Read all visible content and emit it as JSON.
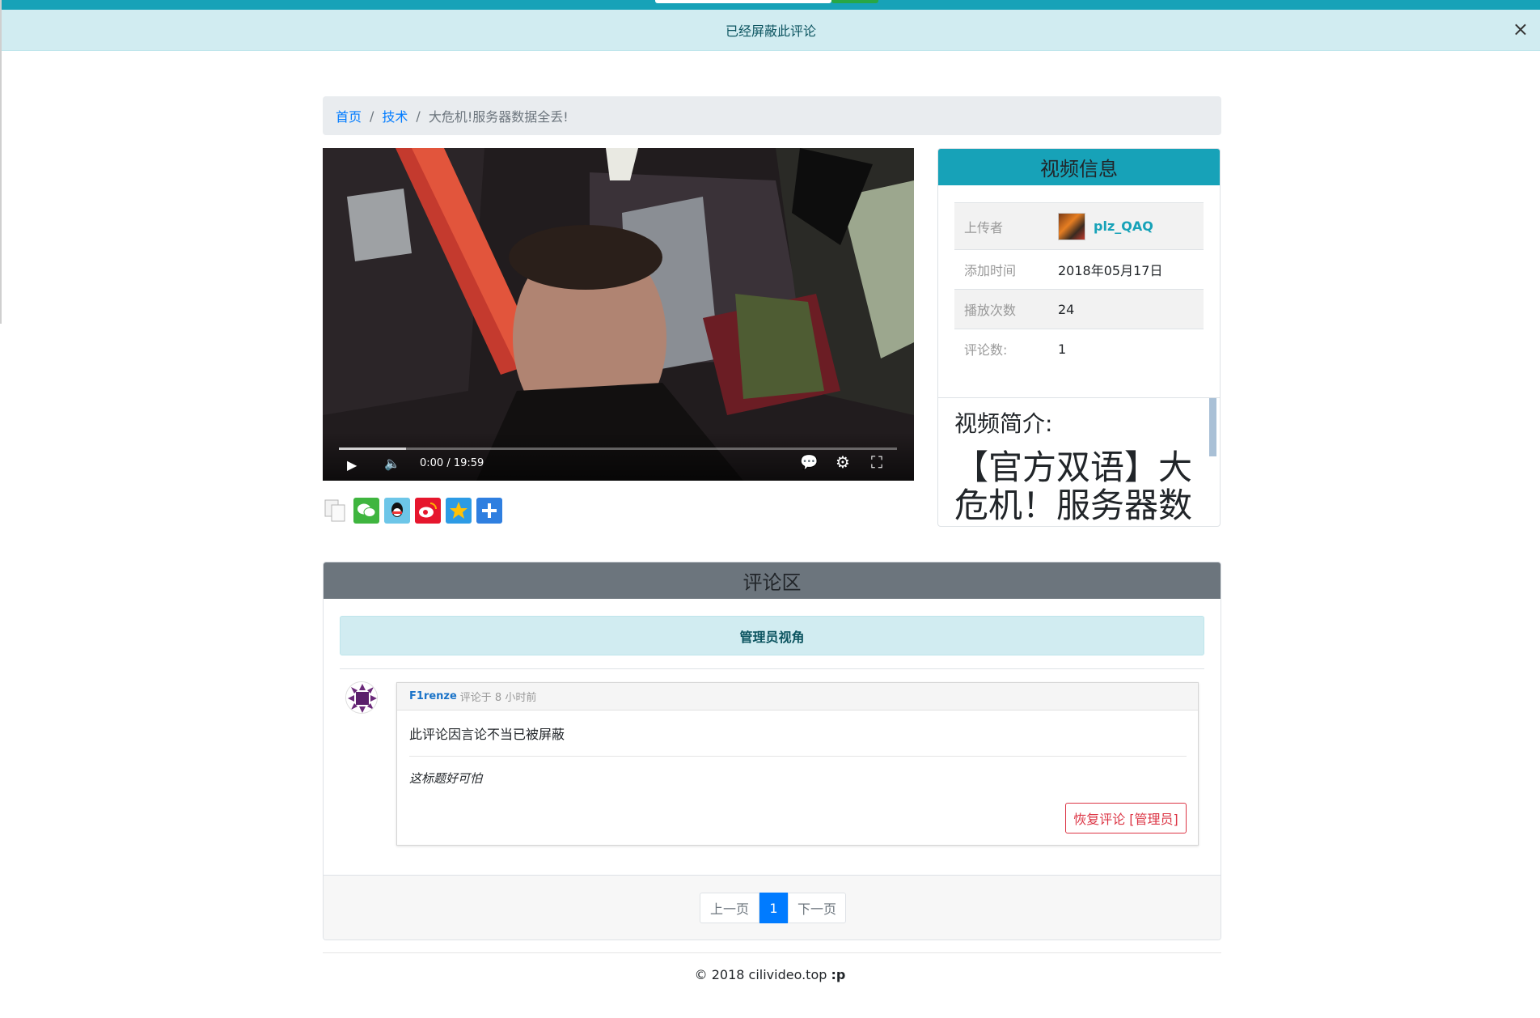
{
  "notice": {
    "text": "已经屏蔽此评论",
    "close": "×"
  },
  "breadcrumb": {
    "home": "首页",
    "category": "技术",
    "current": "大危机!服务器数据全丢!"
  },
  "player": {
    "time": "0:00 / 19:59",
    "progress_buffered": 0.12
  },
  "info": {
    "title": "视频信息",
    "rows": [
      {
        "key": "上传者",
        "value": "plz_QAQ"
      },
      {
        "key": "添加时间",
        "value": "2018年05月17日"
      },
      {
        "key": "播放次数",
        "value": "24"
      },
      {
        "key": "评论数:",
        "value": "1"
      }
    ],
    "desc_label": "视频简介:",
    "desc_text": "【官方双语】大危机！服务器数"
  },
  "comments": {
    "title": "评论区",
    "admin_view": "管理员视角",
    "items": [
      {
        "user": "F1renze",
        "meta": "评论于 8 小时前",
        "body": "此评论因言论不当已被屏蔽",
        "note": "这标题好可怕",
        "action": "恢复评论 [管理员]"
      }
    ],
    "pager": {
      "prev": "上一页",
      "current": "1",
      "next": "下一页"
    }
  },
  "footer": {
    "text": "© 2018  cilivideo.top",
    "suffix": ":p"
  },
  "colors": {
    "accent": "#17a2b8",
    "secondary": "#6c757d",
    "danger": "#dc3545",
    "primary": "#007bff"
  }
}
